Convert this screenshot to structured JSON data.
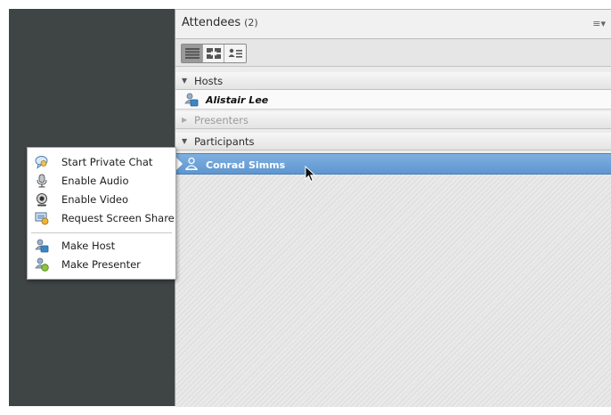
{
  "pod": {
    "title": "Attendees",
    "count": "(2)",
    "menu_glyph": "≡▾"
  },
  "toolbar": {
    "buttons": [
      "list-view-icon",
      "grid-view-icon",
      "status-view-icon"
    ]
  },
  "sections": {
    "hosts": {
      "label": "Hosts",
      "expanded": true,
      "members": [
        "Alistair Lee"
      ]
    },
    "presenters": {
      "label": "Presenters",
      "expanded": false
    },
    "participants": {
      "label": "Participants",
      "expanded": true,
      "members": [
        "Conrad Simms"
      ]
    }
  },
  "context_menu": {
    "items": [
      {
        "label": "Start Private Chat",
        "icon": "chat-bubble-icon"
      },
      {
        "label": "Enable Audio",
        "icon": "microphone-icon"
      },
      {
        "label": "Enable Video",
        "icon": "webcam-icon"
      },
      {
        "label": "Request Screen Share",
        "icon": "screen-share-icon"
      },
      {
        "label": "Make Host",
        "icon": "host-user-icon"
      },
      {
        "label": "Make Presenter",
        "icon": "presenter-user-icon"
      }
    ]
  },
  "colors": {
    "selection": "#6aa0d6",
    "dark_panel": "#3f4445",
    "pod_background": "#ececec"
  }
}
